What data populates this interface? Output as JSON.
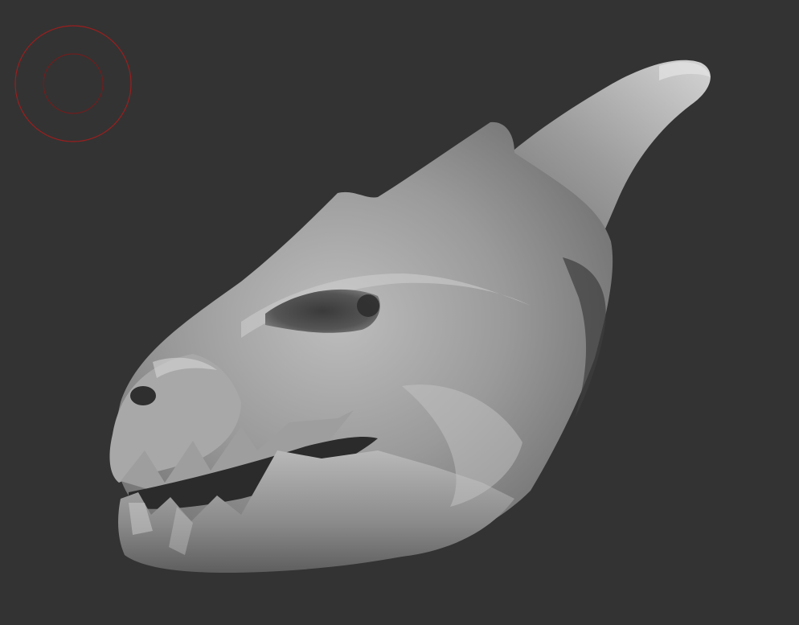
{
  "viewport": {
    "background_color": "#333333",
    "model_base_color": "#8e8e8e",
    "model_highlight_color": "#d8d8d8",
    "model_shadow_color": "#3a3a3a"
  },
  "brush_cursor": {
    "icon": "brush-radius-icon",
    "color": "#9b1e1e"
  }
}
